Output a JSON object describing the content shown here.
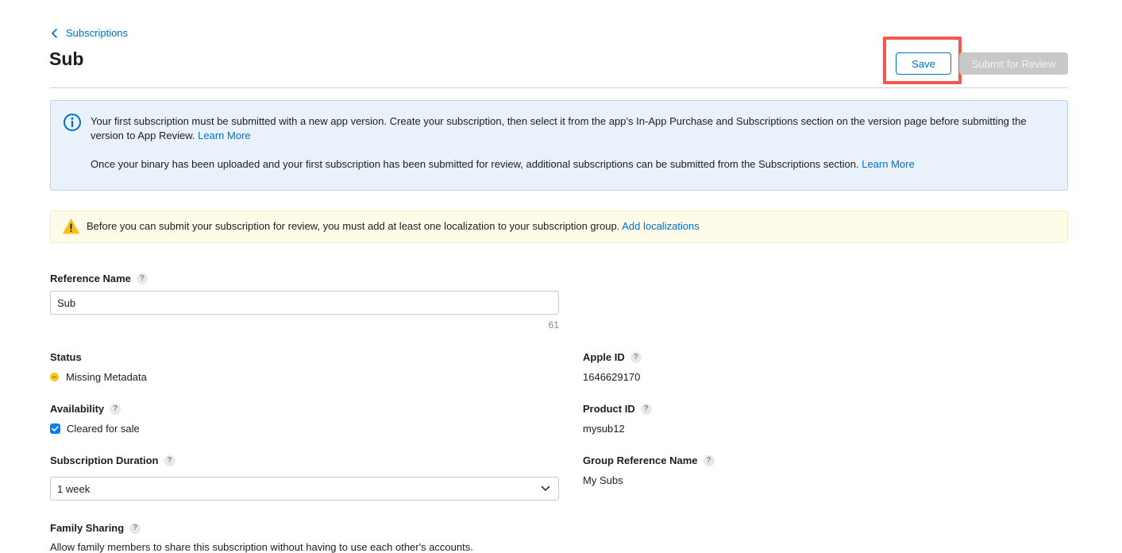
{
  "breadcrumb": {
    "label": "Subscriptions"
  },
  "page": {
    "title": "Sub"
  },
  "toolbar": {
    "save_label": "Save",
    "submit_label": "Submit for Review"
  },
  "info_banner": {
    "para1_text": "Your first subscription must be submitted with a new app version. Create your subscription, then select it from the app’s In-App Purchase and Subscriptions section on the version page before submitting the version to App Review.",
    "para1_link": "Learn More",
    "para2_text": "Once your binary has been uploaded and your first subscription has been submitted for review, additional subscriptions can be submitted from the Subscriptions section.",
    "para2_link": "Learn More"
  },
  "warning_banner": {
    "text": "Before you can submit your subscription for review, you must add at least one localization to your subscription group.",
    "link": "Add localizations"
  },
  "reference_name": {
    "label": "Reference Name",
    "help": "?",
    "value": "Sub",
    "char_count": "61"
  },
  "status": {
    "label": "Status",
    "value": "Missing Metadata",
    "color": "#f5c518"
  },
  "availability": {
    "label": "Availability",
    "help": "?",
    "checkbox_label": "Cleared for sale",
    "checked": true
  },
  "subscription_duration": {
    "label": "Subscription Duration",
    "help": "?",
    "selected": "1 week"
  },
  "family_sharing": {
    "label": "Family Sharing",
    "help": "?",
    "description": "Allow family members to share this subscription without having to use each other's accounts."
  },
  "apple_id": {
    "label": "Apple ID",
    "help": "?",
    "value": "1646629170"
  },
  "product_id": {
    "label": "Product ID",
    "help": "?",
    "value": "mysub12"
  },
  "group_reference_name": {
    "label": "Group Reference Name",
    "help": "?",
    "value": "My Subs"
  },
  "colors": {
    "accent": "#0070c9",
    "highlight": "#f4574f",
    "info_bg": "#e9f2fb",
    "warning_bg": "#fefbe9"
  }
}
